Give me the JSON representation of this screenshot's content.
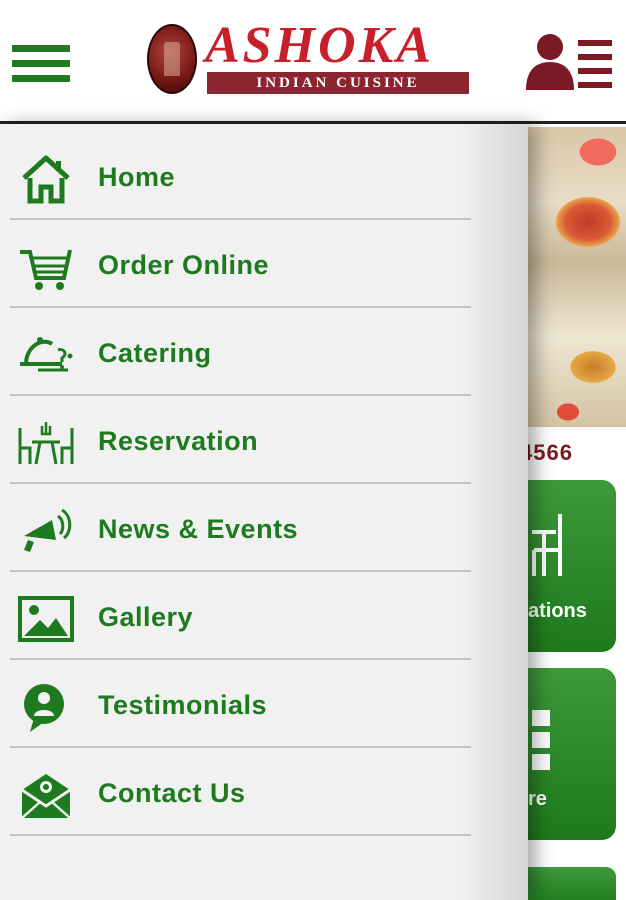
{
  "header": {
    "logo": {
      "name": "ASHOKA",
      "tagline": "INDIAN CUISINE"
    }
  },
  "background": {
    "phone_fragment": "4566",
    "tile1_label_fragment": "ations",
    "tile2_label_fragment": "re"
  },
  "menu": {
    "items": [
      {
        "label": "Home",
        "icon": "home-icon"
      },
      {
        "label": "Order Online",
        "icon": "cart-icon"
      },
      {
        "label": "Catering",
        "icon": "catering-icon"
      },
      {
        "label": "Reservation",
        "icon": "reservation-icon"
      },
      {
        "label": "News & Events",
        "icon": "megaphone-icon"
      },
      {
        "label": "Gallery",
        "icon": "gallery-icon"
      },
      {
        "label": "Testimonials",
        "icon": "testimonial-icon"
      },
      {
        "label": "Contact Us",
        "icon": "mail-icon"
      }
    ]
  },
  "colors": {
    "accent_green": "#1e7a1e",
    "brand_red": "#c8202a",
    "maroon": "#7b1a25",
    "drawer_bg": "#f1f1f1"
  }
}
